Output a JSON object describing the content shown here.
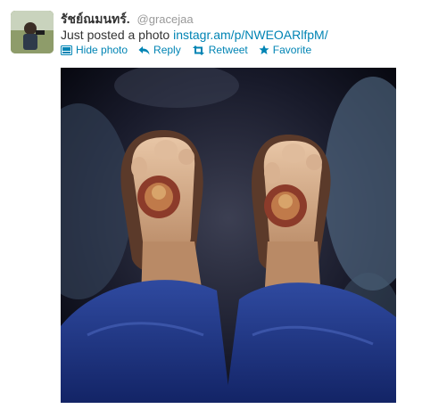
{
  "tweet": {
    "name": "รัชย์ณมนทร์.",
    "handle": "@gracejaa",
    "text_prefix": "Just posted a photo",
    "link_text": "instagr.am/p/NWEOARlfpM/"
  },
  "actions": {
    "hide_photo": "Hide photo",
    "reply": "Reply",
    "retweet": "Retweet",
    "favorite": "Favorite"
  },
  "icons": {
    "hide_photo": "photo-icon",
    "reply": "reply-arrow-icon",
    "retweet": "retweet-icon",
    "favorite": "star-icon"
  },
  "colors": {
    "link": "#0084b4",
    "name": "#333333",
    "handle": "#999999"
  }
}
